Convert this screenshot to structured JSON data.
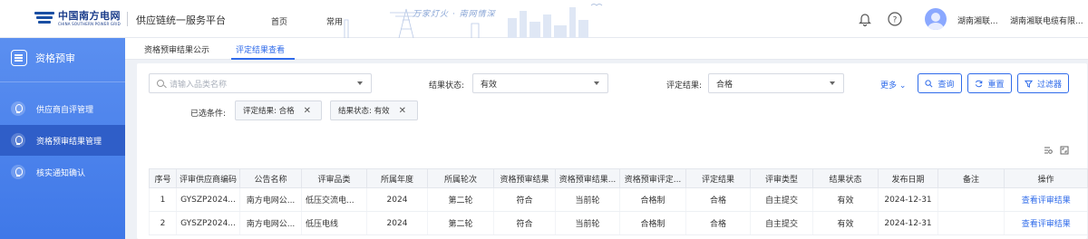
{
  "header": {
    "logo_cn": "中国南方电网",
    "logo_en": "CHINA SOUTHERN POWER GRID",
    "platform": "供应链统一服务平台",
    "nav": [
      "首页",
      "常用"
    ],
    "slogan": "万家灯火 · 南网情深",
    "user_name": "湖南湘联...",
    "company": "湖南湘联电缆有限...",
    "icons": [
      "bell-icon",
      "help-icon",
      "avatar"
    ]
  },
  "sidebar": {
    "title": "资格预审",
    "items": [
      {
        "label": "供应商自评管理",
        "active": false
      },
      {
        "label": "资格预审结果管理",
        "active": true
      },
      {
        "label": "核实通知确认",
        "active": false
      }
    ]
  },
  "tabs": [
    {
      "label": "资格预审结果公示",
      "active": false
    },
    {
      "label": "评定结果查看",
      "active": true
    }
  ],
  "filters": {
    "search_placeholder": "请输入品类名称",
    "status_label": "结果状态:",
    "status_value": "有效",
    "result_label": "评定结果:",
    "result_value": "合格",
    "more_label": "更多",
    "query_label": "查询",
    "reset_label": "重置",
    "filter_label": "过滤器",
    "chosen_label": "已选条件:",
    "chips": [
      "评定结果: 合格",
      "结果状态: 有效"
    ]
  },
  "table": {
    "columns": [
      "序号",
      "评审供应商编码",
      "公告名称",
      "评审品类",
      "所属年度",
      "所属轮次",
      "资格预审结果",
      "资格预审结果...",
      "资格预审评定...",
      "评定结果",
      "评审类型",
      "结果状态",
      "发布日期",
      "备注",
      "操作"
    ],
    "rows": [
      [
        "1",
        "GYSZP2024...",
        "南方电网公...",
        "低压交流电...",
        "2024",
        "第二轮",
        "符合",
        "当前轮",
        "合格制",
        "合格",
        "自主提交",
        "有效",
        "2024-12-31",
        "",
        "查看评审结果"
      ],
      [
        "2",
        "GYSZP2024...",
        "南方电网公...",
        "低压电线",
        "2024",
        "第二轮",
        "符合",
        "当前轮",
        "合格制",
        "合格",
        "自主提交",
        "有效",
        "2024-12-31",
        "",
        "查看评审结果"
      ]
    ]
  },
  "colors": {
    "primary": "#2f6bea",
    "sidebar": "#4a82ec",
    "sidebar_active": "#2f5ec8"
  }
}
